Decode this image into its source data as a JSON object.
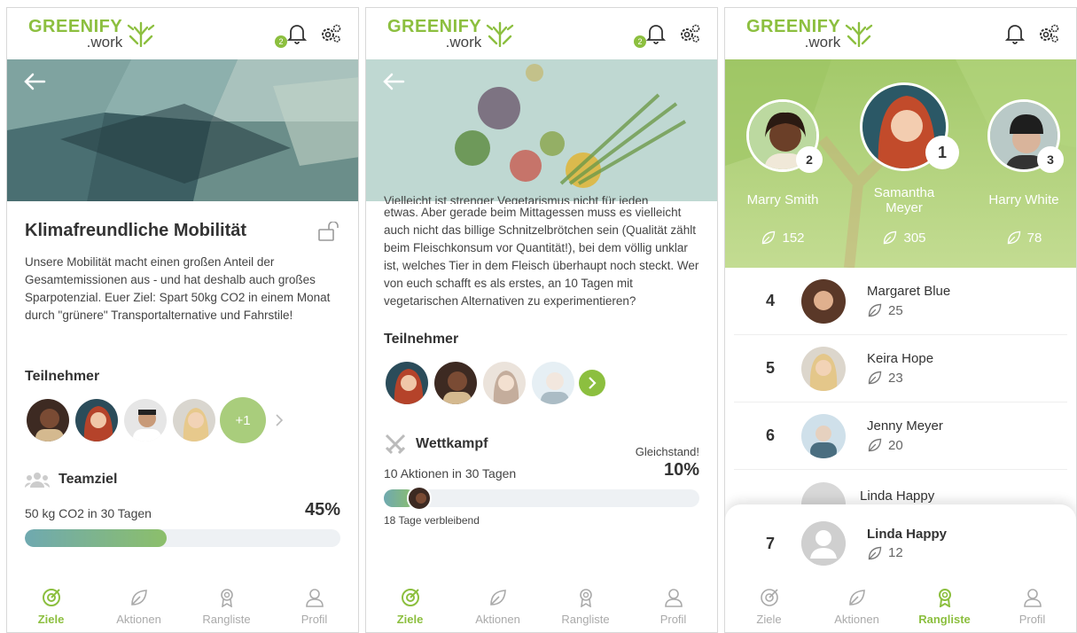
{
  "brand": {
    "name": "GREENIFY",
    "sub": ".work"
  },
  "notification_count": "2",
  "nav": [
    {
      "label": "Ziele"
    },
    {
      "label": "Aktionen"
    },
    {
      "label": "Rangliste"
    },
    {
      "label": "Profil"
    }
  ],
  "screen1": {
    "title": "Klimafreundliche Mobilität",
    "description": "Unsere Mobilität macht einen großen Anteil der Gesamtemissionen aus - und hat deshalb auch großes Sparpotenzial. Euer Ziel: Spart 50kg CO2 in einem Monat durch \"grünere\" Transportalternative und Fahrstile!",
    "participants_heading": "Teilnehmer",
    "extra_participants": "+1",
    "team_goal_heading": "Teamziel",
    "goal_text": "50 kg CO2 in 30 Tagen",
    "progress_label": "45%",
    "progress": 0.45
  },
  "screen2": {
    "description_cut": "Vielleicht ist strenger Vegetarismus nicht für jeden",
    "description": "etwas. Aber gerade beim Mittagessen muss es vielleicht auch nicht das billige Schnitzelbrötchen sein (Qualität zählt beim Fleischkonsum vor Quantität!), bei dem völlig unklar ist, welches Tier in dem Fleisch überhaupt noch steckt. Wer von euch schafft es als erstes, an 10 Tagen mit vegetarischen Alternativen zu experimentieren?",
    "participants_heading": "Teilnehmer",
    "competition_heading": "Wettkampf",
    "status": "Gleichstand!",
    "goal_text": "10 Aktionen in 30 Tagen",
    "progress_label": "10%",
    "progress": 0.1,
    "remaining": "18 Tage verbleibend"
  },
  "screen3": {
    "podium": [
      {
        "rank": "2",
        "name": "Marry Smith",
        "points": "152"
      },
      {
        "rank": "1",
        "name": "Samantha Meyer",
        "points": "305"
      },
      {
        "rank": "3",
        "name": "Harry White",
        "points": "78"
      }
    ],
    "list": [
      {
        "rank": "4",
        "name": "Margaret Blue",
        "points": "25"
      },
      {
        "rank": "5",
        "name": "Keira Hope",
        "points": "23"
      },
      {
        "rank": "6",
        "name": "Jenny Meyer",
        "points": "20"
      }
    ],
    "partial_name": "Linda Happy",
    "self": {
      "rank": "7",
      "name": "Linda Happy",
      "points": "12"
    }
  },
  "colors": {
    "brand_green": "#8cbf3f",
    "teal": "#6fa9b0"
  }
}
